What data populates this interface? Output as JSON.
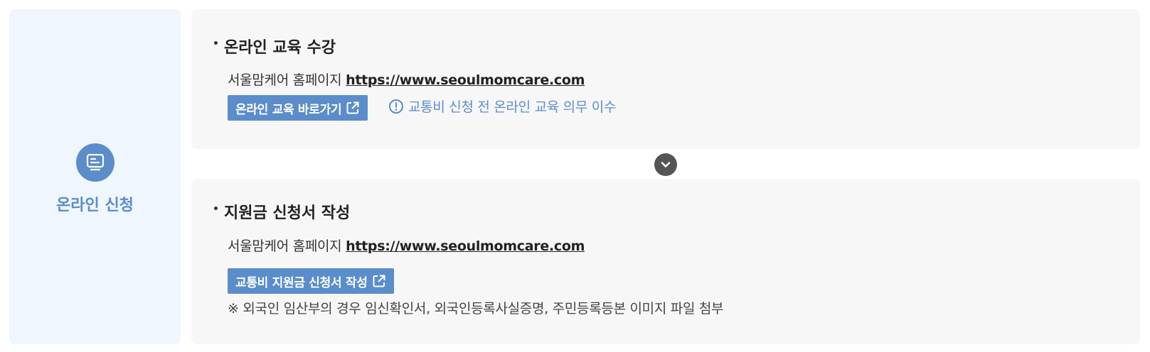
{
  "sidebar": {
    "title": "온라인 신청",
    "icon": "monitor-icon",
    "accent": "#5b8dcb"
  },
  "step1": {
    "title": "온라인 교육 수강",
    "homepage_label": "서울맘케어 홈페이지",
    "homepage_url": "https://www.seoulmomcare.com",
    "button_label": "온라인 교육 바로가기",
    "button_icon": "external-link-icon",
    "info_icon": "alert-circle-icon",
    "info_text": "교통비 신청 전 온라인 교육 의무 이수"
  },
  "divider": {
    "icon": "chevron-down-icon"
  },
  "step2": {
    "title": "지원금 신청서 작성",
    "homepage_label": "서울맘케어 홈페이지",
    "homepage_url": "https://www.seoulmomcare.com",
    "button_label": "교통비 지원금 신청서 작성",
    "button_icon": "external-link-icon",
    "note": "※ 외국인 임산부의 경우 임신확인서, 외국인등록사실증명, 주민등록등본 이미지 파일 첨부"
  }
}
